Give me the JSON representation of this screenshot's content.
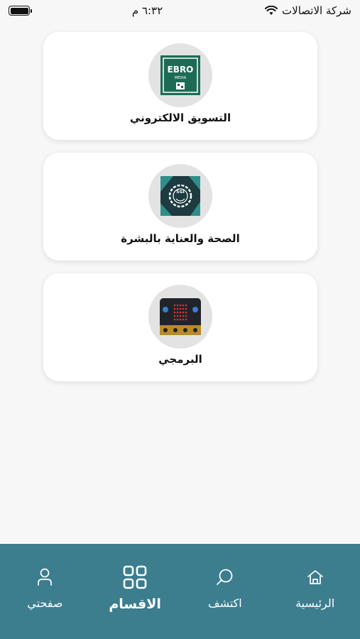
{
  "status_bar": {
    "carrier": "شركة الاتصالات",
    "time": "٦:٣٢ م",
    "battery_percent": 100
  },
  "cards": [
    {
      "title": "التسويق الالكتروني",
      "image_text": "EBRO",
      "image_subtext": "MEDIA",
      "icon": "ebro-media-logo"
    },
    {
      "title": "الصحة والعناية بالبشرة",
      "image_text": "SGI",
      "icon": "gear-badge-logo"
    },
    {
      "title": "البرمجي",
      "icon": "microbit-board-image"
    }
  ],
  "bottom_nav": {
    "items": [
      {
        "label": "الرئيسية",
        "icon": "home-icon",
        "active": false
      },
      {
        "label": "اكتشف",
        "icon": "search-icon",
        "active": false
      },
      {
        "label": "الاقسام",
        "icon": "grid-icon",
        "active": true
      },
      {
        "label": "صفحتي",
        "icon": "user-icon",
        "active": false
      }
    ]
  },
  "colors": {
    "nav_background": "#3c7d8e",
    "ebro_green": "#1e6b55",
    "card_background": "#ffffff",
    "page_background": "#f7f7f7"
  }
}
